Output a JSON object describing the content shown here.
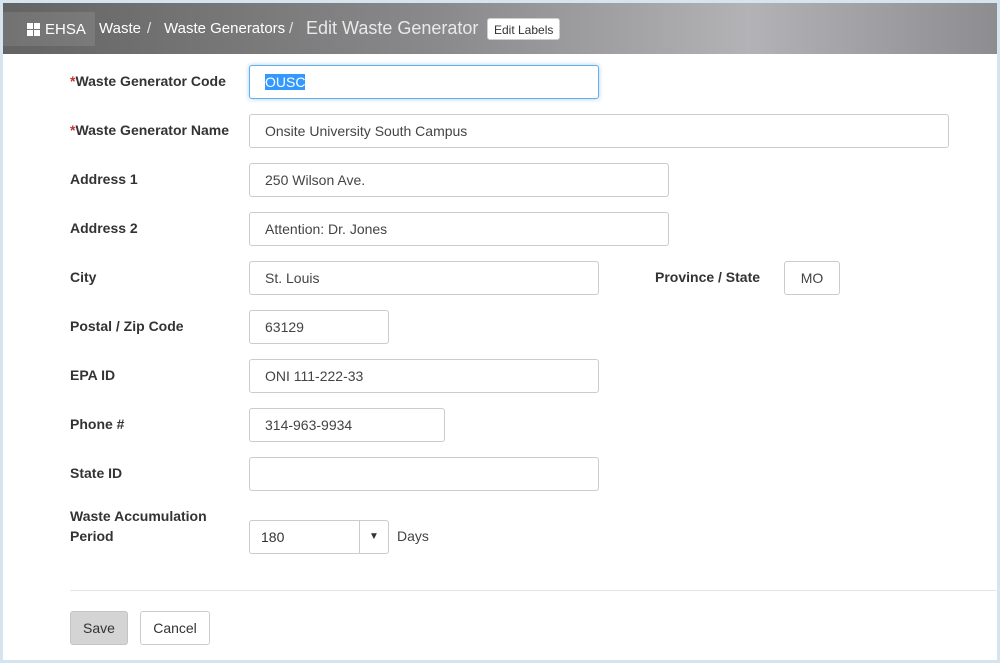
{
  "header": {
    "brand": "EHSA",
    "breadcrumb": [
      "Waste",
      "Waste Generators"
    ],
    "separator": "/",
    "current": "Edit Waste Generator",
    "edit_labels": "Edit Labels"
  },
  "form": {
    "required_mark": "*",
    "code": {
      "label": "Waste Generator Code",
      "value": "OUSC"
    },
    "name": {
      "label": "Waste Generator Name",
      "value": "Onsite University South Campus"
    },
    "address1": {
      "label": "Address 1",
      "value": "250 Wilson Ave."
    },
    "address2": {
      "label": "Address 2",
      "value": "Attention: Dr. Jones"
    },
    "city": {
      "label": "City",
      "value": "St. Louis"
    },
    "province": {
      "label": "Province / State",
      "value": "MO"
    },
    "postal": {
      "label": "Postal / Zip Code",
      "value": "63129"
    },
    "epa": {
      "label": "EPA ID",
      "value": "ONI 111-222-33"
    },
    "phone": {
      "label": "Phone #",
      "value": "314-963-9934"
    },
    "state_id": {
      "label": "State ID",
      "value": ""
    },
    "accumulation": {
      "label_line1": "Waste Accumulation",
      "label_line2": "Period",
      "selected": "180",
      "arrow": "▼",
      "unit": "Days"
    }
  },
  "actions": {
    "save": "Save",
    "cancel": "Cancel"
  },
  "colors": {
    "required": "#c9302c",
    "focus": "#66afe9",
    "selection": "#3399ff"
  },
  "icons": {
    "brand": "grid-icon",
    "select": "chevron-down-icon"
  }
}
